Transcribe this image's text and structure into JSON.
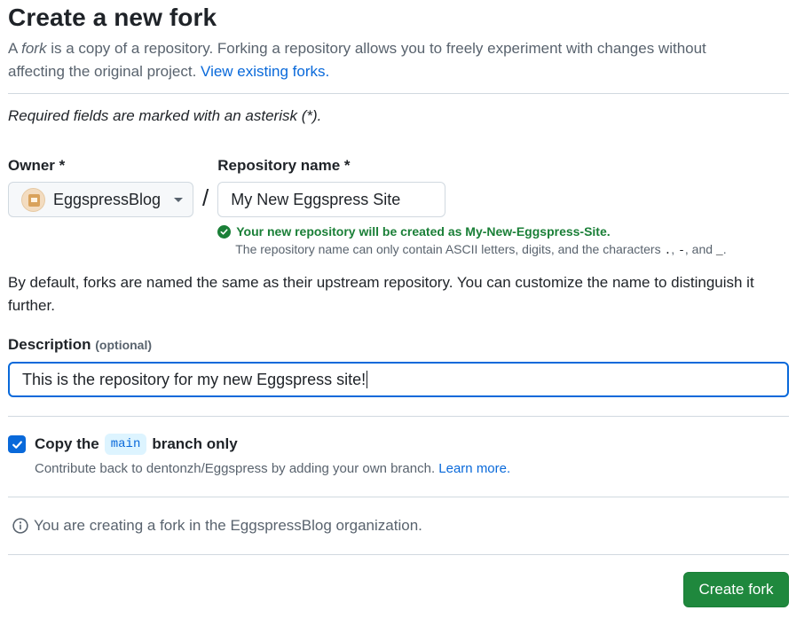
{
  "header": {
    "title": "Create a new fork",
    "intro_prefix": "A ",
    "intro_fork": "fork",
    "intro_rest": " is a copy of a repository. Forking a repository allows you to freely experiment with changes without affecting the original project. ",
    "view_forks_link": "View existing forks."
  },
  "form": {
    "required_note": "Required fields are marked with an asterisk (*).",
    "owner_label": "Owner *",
    "owner_value": "EggspressBlog",
    "slash": "/",
    "repo_label": "Repository name *",
    "repo_value": "My New Eggspress Site",
    "valid_message": "Your new repository will be created as My-New-Eggspress-Site.",
    "hint_prefix": "The repository name can only contain ASCII letters, digits, and the characters ",
    "hint_chars_1": ".",
    "hint_sep_1": ", ",
    "hint_chars_2": "-",
    "hint_sep_2": ", and ",
    "hint_chars_3": "_",
    "hint_end": ".",
    "naming_paragraph": "By default, forks are named the same as their upstream repository. You can customize the name to distinguish it further.",
    "description_label": "Description",
    "description_optional": "(optional)",
    "description_value": "This is the repository for my new Eggspress site!",
    "copy_prefix": "Copy the",
    "copy_branch": "main",
    "copy_suffix": "branch only",
    "copy_checked": true,
    "copy_sub_text": "Contribute back to dentonzh/Eggspress by adding your own branch. ",
    "learn_more": "Learn more.",
    "info_text": "You are creating a fork in the EggspressBlog organization.",
    "submit_label": "Create fork"
  },
  "colors": {
    "accent": "#0969da",
    "success": "#1a7f37",
    "button": "#1f883d"
  }
}
